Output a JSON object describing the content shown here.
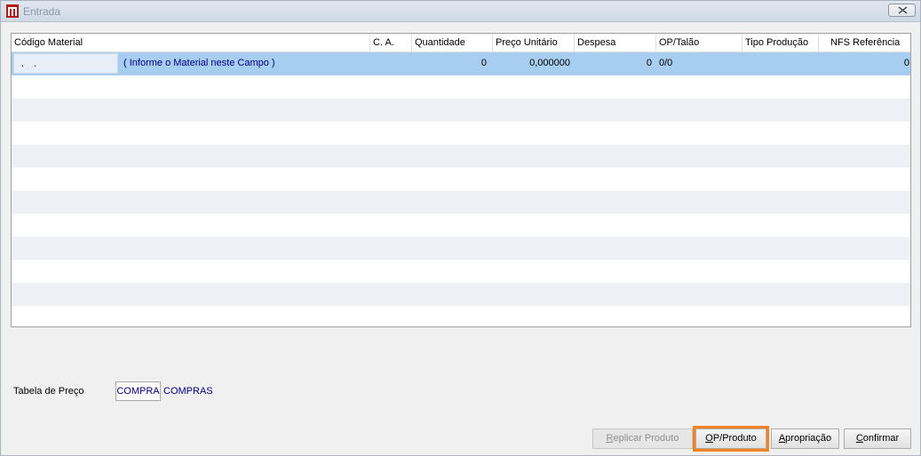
{
  "window": {
    "title": "Entrada",
    "close_icon": "close-icon"
  },
  "grid": {
    "columns": [
      "Código Material",
      "C. A.",
      "Quantidade",
      "Preço Unitário",
      "Despesa",
      "OP/Talão",
      "Tipo Produção",
      "NFS Referência"
    ],
    "first_row": {
      "codigo": ". .",
      "hint": "( Informe o Material neste Campo )",
      "ca": "",
      "quantidade": "0",
      "preco_unitario": "0,000000",
      "despesa": "0",
      "op_talao": "0/0",
      "tipo_producao": "",
      "nfs_referencia": "0"
    }
  },
  "tabela_preco": {
    "label": "Tabela de Preço",
    "value": "COMPRA",
    "description": "COMPRAS"
  },
  "buttons": {
    "replicar": {
      "first": "R",
      "rest": "eplicar Produto"
    },
    "op_produto": {
      "first": "O",
      "rest": "P/Produto"
    },
    "apropriacao": {
      "first": "A",
      "rest": "propriação"
    },
    "confirmar": {
      "first": "C",
      "rest": "onfirmar"
    }
  },
  "colors": {
    "selected_row": "#a7cdf0",
    "highlight_outline": "#f58220",
    "link_text": "#000080"
  }
}
